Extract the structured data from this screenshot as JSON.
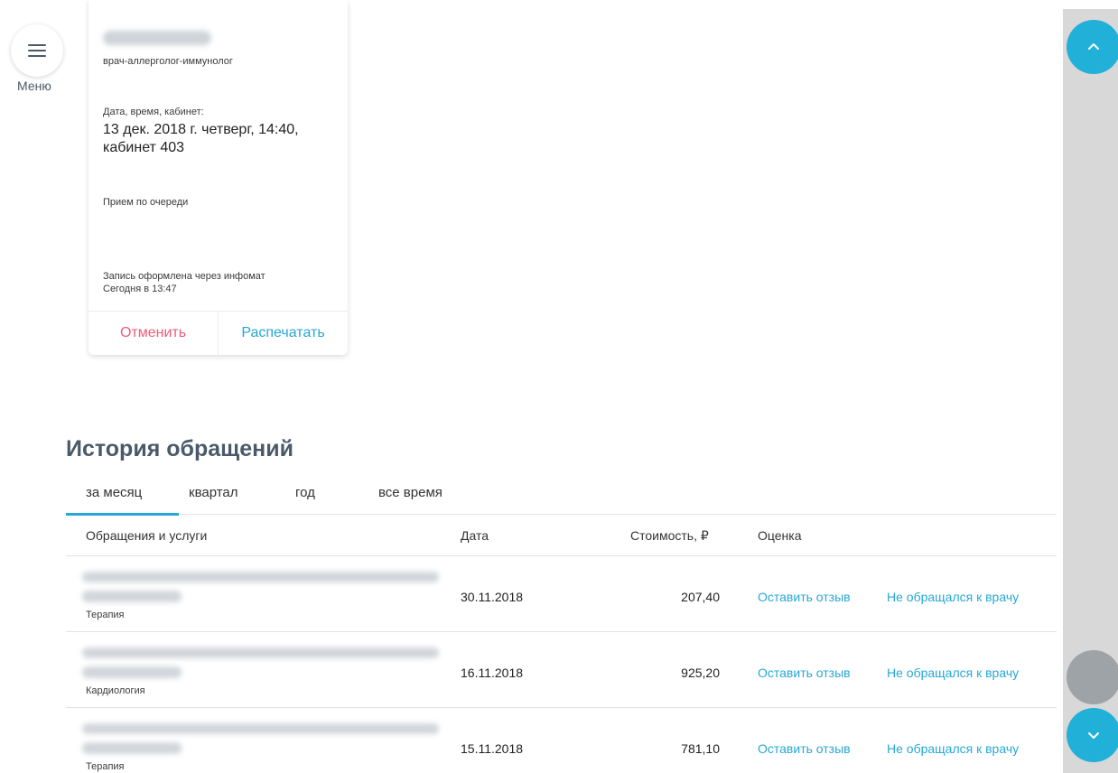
{
  "menu": {
    "label": "Меню",
    "icon": "hamburger-icon"
  },
  "card": {
    "specialty": "врач-аллерголог-иммунолог",
    "datetime_label": "Дата, время, кабинет:",
    "datetime_value": "13 дек. 2018 г. четверг, 14:40, кабинет 403",
    "queue_text": "Прием по очереди",
    "booked_via": "Запись оформлена через инфомат",
    "booked_time": "Сегодня в 13:47",
    "cancel_label": "Отменить",
    "print_label": "Распечатать"
  },
  "history": {
    "title": "История обращений",
    "tabs": [
      {
        "label": "за месяц",
        "active": true
      },
      {
        "label": "квартал",
        "active": false
      },
      {
        "label": "год",
        "active": false
      },
      {
        "label": "все время",
        "active": false
      }
    ],
    "columns": {
      "services": "Обращения и услуги",
      "date": "Дата",
      "cost": "Стоимость, ₽",
      "rating": "Оценка"
    },
    "rows": [
      {
        "category": "Терапия",
        "date": "30.11.2018",
        "cost": "207,40",
        "review": "Оставить отзыв",
        "not_visited": "Не обращался к врачу"
      },
      {
        "category": "Кардиология",
        "date": "16.11.2018",
        "cost": "925,20",
        "review": "Оставить отзыв",
        "not_visited": "Не обращался к врачу"
      },
      {
        "category": "Терапия",
        "date": "15.11.2018",
        "cost": "781,10",
        "review": "Оставить отзыв",
        "not_visited": "Не обращался к врачу"
      }
    ]
  },
  "colors": {
    "accent": "#26a8d6",
    "cancel": "#ef5c7a",
    "fab_blue": "#21b0d8",
    "fab_gray": "#9ea3a8",
    "heading": "#4a5a6a"
  },
  "scroll_buttons": {
    "up_icon": "chevron-up-icon",
    "down_icon": "chevron-down-icon"
  }
}
